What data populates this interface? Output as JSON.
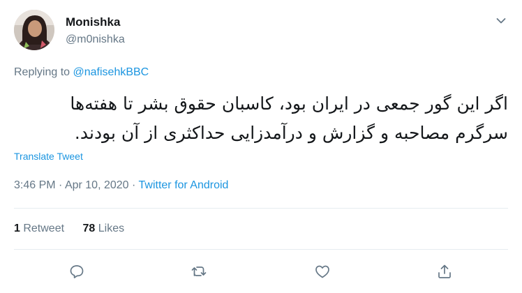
{
  "user": {
    "display_name": "Monishka",
    "handle": "@m0nishka"
  },
  "reply": {
    "prefix": "Replying to ",
    "to_handle": "@nafisehkBBC"
  },
  "tweet": {
    "text": "اگر این گور جمعی در ایران بود، کاسبان حقوق بشر تا هفته‌ها سرگرم مصاحبه و گزارش و درآمدزایی حداکثری از آن بودند.",
    "translate_label": "Translate Tweet",
    "time": "3:46 PM",
    "separator": " · ",
    "date": "Apr 10, 2020",
    "source": "Twitter for Android"
  },
  "stats": {
    "retweets_count": "1",
    "retweets_label": " Retweet",
    "likes_count": "78",
    "likes_label": " Likes"
  },
  "icons": {
    "more": "chevron-down-icon",
    "reply": "reply-icon",
    "retweet": "retweet-icon",
    "like": "heart-icon",
    "share": "share-icon"
  },
  "colors": {
    "text": "#14171a",
    "muted": "#657786",
    "link": "#1b95e0",
    "divider": "#e6ecf0"
  }
}
